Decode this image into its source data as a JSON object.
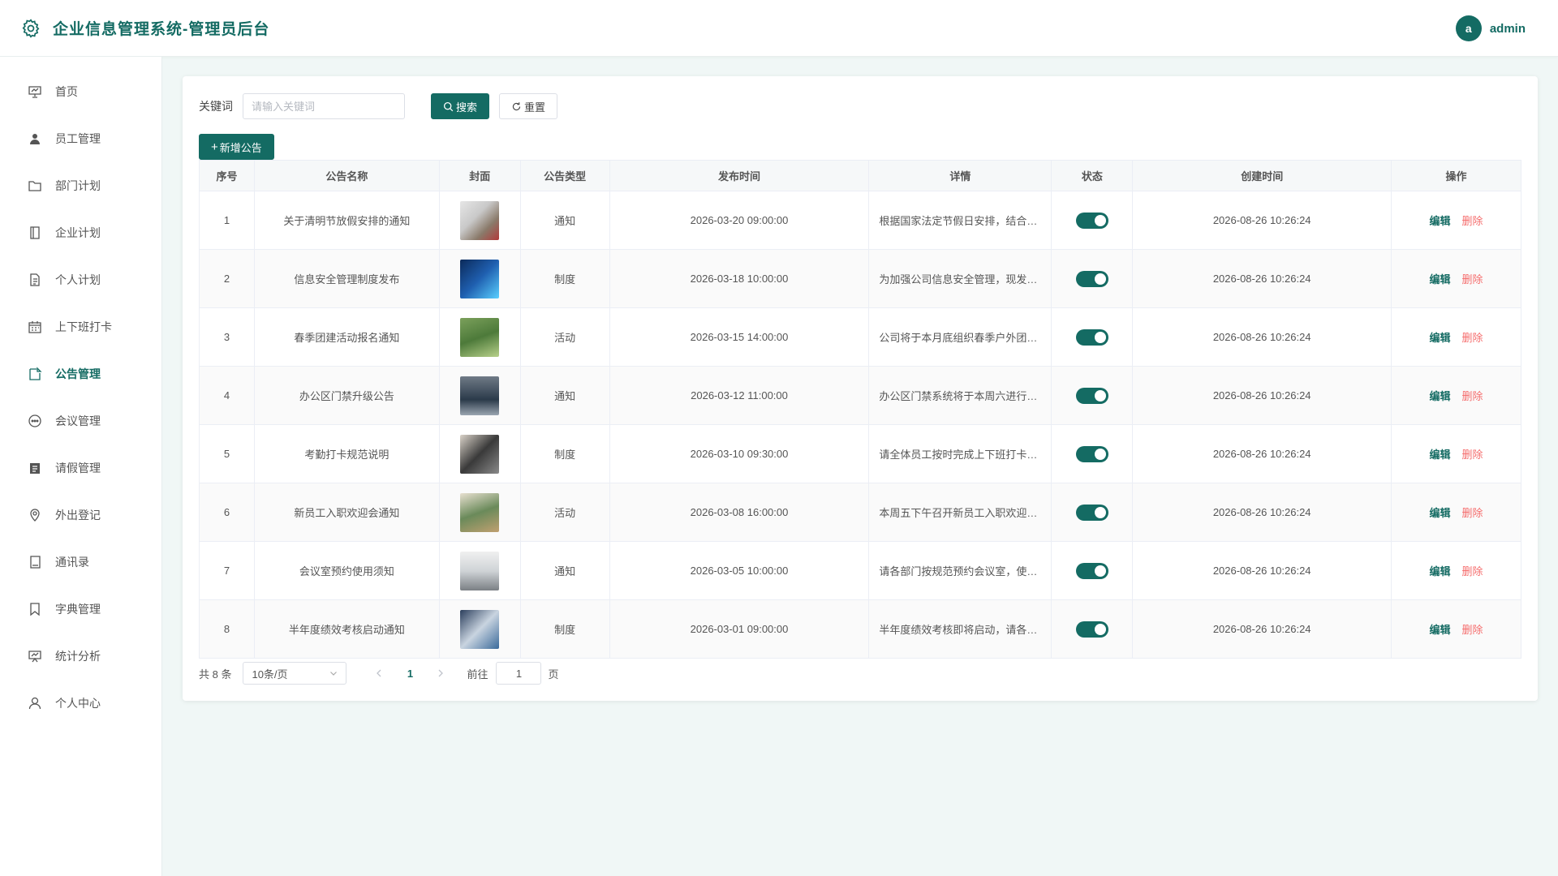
{
  "header": {
    "title": "企业信息管理系统-管理员后台",
    "avatar_letter": "a",
    "username": "admin",
    "accent": "#146b63"
  },
  "sidebar": {
    "items": [
      {
        "label": "首页",
        "icon": "presentation-icon"
      },
      {
        "label": "员工管理",
        "icon": "user-icon"
      },
      {
        "label": "部门计划",
        "icon": "folder-icon"
      },
      {
        "label": "企业计划",
        "icon": "notebook-icon"
      },
      {
        "label": "个人计划",
        "icon": "document-icon"
      },
      {
        "label": "上下班打卡",
        "icon": "calendar-icon"
      },
      {
        "label": "公告管理",
        "icon": "notice-icon",
        "active": true
      },
      {
        "label": "会议管理",
        "icon": "chat-icon"
      },
      {
        "label": "请假管理",
        "icon": "clipboard-icon"
      },
      {
        "label": "外出登记",
        "icon": "location-icon"
      },
      {
        "label": "通讯录",
        "icon": "contacts-icon"
      },
      {
        "label": "字典管理",
        "icon": "bookmark-icon"
      },
      {
        "label": "统计分析",
        "icon": "chart-icon"
      },
      {
        "label": "个人中心",
        "icon": "profile-icon"
      }
    ]
  },
  "search": {
    "label": "关键词",
    "placeholder": "请输入关键词",
    "search_label": "搜索",
    "reset_label": "重置"
  },
  "add_label": "新增公告",
  "table": {
    "headers": [
      "序号",
      "公告名称",
      "封面",
      "公告类型",
      "发布时间",
      "详情",
      "状态",
      "创建时间",
      "操作"
    ],
    "edit_label": "编辑",
    "delete_label": "删除",
    "rows": [
      {
        "no": "1",
        "name": "关于清明节放假安排的通知",
        "type": "通知",
        "publish": "2026-03-20 09:00:00",
        "detail": "根据国家法定节假日安排，结合公司实际情况，现将清明节放假安排通知如下",
        "created": "2026-08-26 10:26:24"
      },
      {
        "no": "2",
        "name": "信息安全管理制度发布",
        "type": "制度",
        "publish": "2026-03-18 10:00:00",
        "detail": "为加强公司信息安全管理，现发布新版信息安全管理制度",
        "created": "2026-08-26 10:26:24"
      },
      {
        "no": "3",
        "name": "春季团建活动报名通知",
        "type": "活动",
        "publish": "2026-03-15 14:00:00",
        "detail": "公司将于本月底组织春季户外团建活动，请大家积极报名",
        "created": "2026-08-26 10:26:24"
      },
      {
        "no": "4",
        "name": "办公区门禁升级公告",
        "type": "通知",
        "publish": "2026-03-12 11:00:00",
        "detail": "办公区门禁系统将于本周六进行升级维护，届时请注意",
        "created": "2026-08-26 10:26:24"
      },
      {
        "no": "5",
        "name": "考勤打卡规范说明",
        "type": "制度",
        "publish": "2026-03-10 09:30:00",
        "detail": "请全体员工按时完成上下班打卡，如有异常及时申报",
        "created": "2026-08-26 10:26:24"
      },
      {
        "no": "6",
        "name": "新员工入职欢迎会通知",
        "type": "活动",
        "publish": "2026-03-08 16:00:00",
        "detail": "本周五下午召开新员工入职欢迎会，请相关人员准时参加",
        "created": "2026-08-26 10:26:24"
      },
      {
        "no": "7",
        "name": "会议室预约使用须知",
        "type": "通知",
        "publish": "2026-03-05 10:00:00",
        "detail": "请各部门按规范预约会议室，使用完毕后及时归还",
        "created": "2026-08-26 10:26:24"
      },
      {
        "no": "8",
        "name": "半年度绩效考核启动通知",
        "type": "制度",
        "publish": "2026-03-01 09:00:00",
        "detail": "半年度绩效考核即将启动，请各部门做好准备工作",
        "created": "2026-08-26 10:26:24"
      }
    ]
  },
  "pagination": {
    "total": "共 8 条",
    "page_size": "10条/页",
    "current": "1",
    "goto_label": "前往",
    "goto_value": "1",
    "goto_unit": "页"
  }
}
